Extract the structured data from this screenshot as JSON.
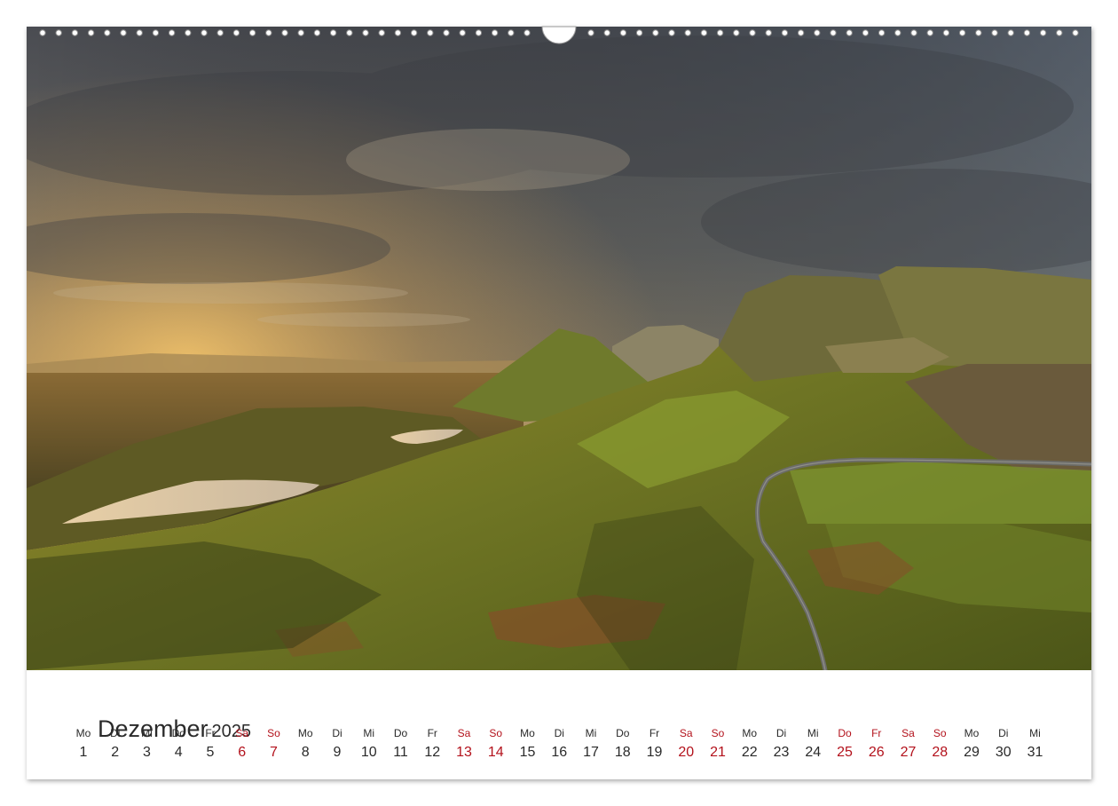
{
  "calendar": {
    "month": "Dezember",
    "year": "2025",
    "days": [
      {
        "wd": "Mo",
        "num": "1",
        "red": false
      },
      {
        "wd": "Di",
        "num": "2",
        "red": false
      },
      {
        "wd": "Mi",
        "num": "3",
        "red": false
      },
      {
        "wd": "Do",
        "num": "4",
        "red": false
      },
      {
        "wd": "Fr",
        "num": "5",
        "red": false
      },
      {
        "wd": "Sa",
        "num": "6",
        "red": true
      },
      {
        "wd": "So",
        "num": "7",
        "red": true
      },
      {
        "wd": "Mo",
        "num": "8",
        "red": false
      },
      {
        "wd": "Di",
        "num": "9",
        "red": false
      },
      {
        "wd": "Mi",
        "num": "10",
        "red": false
      },
      {
        "wd": "Do",
        "num": "11",
        "red": false
      },
      {
        "wd": "Fr",
        "num": "12",
        "red": false
      },
      {
        "wd": "Sa",
        "num": "13",
        "red": true
      },
      {
        "wd": "So",
        "num": "14",
        "red": true
      },
      {
        "wd": "Mo",
        "num": "15",
        "red": false
      },
      {
        "wd": "Di",
        "num": "16",
        "red": false
      },
      {
        "wd": "Mi",
        "num": "17",
        "red": false
      },
      {
        "wd": "Do",
        "num": "18",
        "red": false
      },
      {
        "wd": "Fr",
        "num": "19",
        "red": false
      },
      {
        "wd": "Sa",
        "num": "20",
        "red": true
      },
      {
        "wd": "So",
        "num": "21",
        "red": true
      },
      {
        "wd": "Mo",
        "num": "22",
        "red": false
      },
      {
        "wd": "Di",
        "num": "23",
        "red": false
      },
      {
        "wd": "Mi",
        "num": "24",
        "red": false
      },
      {
        "wd": "Do",
        "num": "25",
        "red": true
      },
      {
        "wd": "Fr",
        "num": "26",
        "red": true
      },
      {
        "wd": "Sa",
        "num": "27",
        "red": true
      },
      {
        "wd": "So",
        "num": "28",
        "red": true
      },
      {
        "wd": "Mo",
        "num": "29",
        "red": false
      },
      {
        "wd": "Di",
        "num": "30",
        "red": false
      },
      {
        "wd": "Mi",
        "num": "31",
        "red": false
      }
    ]
  },
  "colors": {
    "weekend_holiday": "#b3121c",
    "text": "#2a2a2a"
  }
}
